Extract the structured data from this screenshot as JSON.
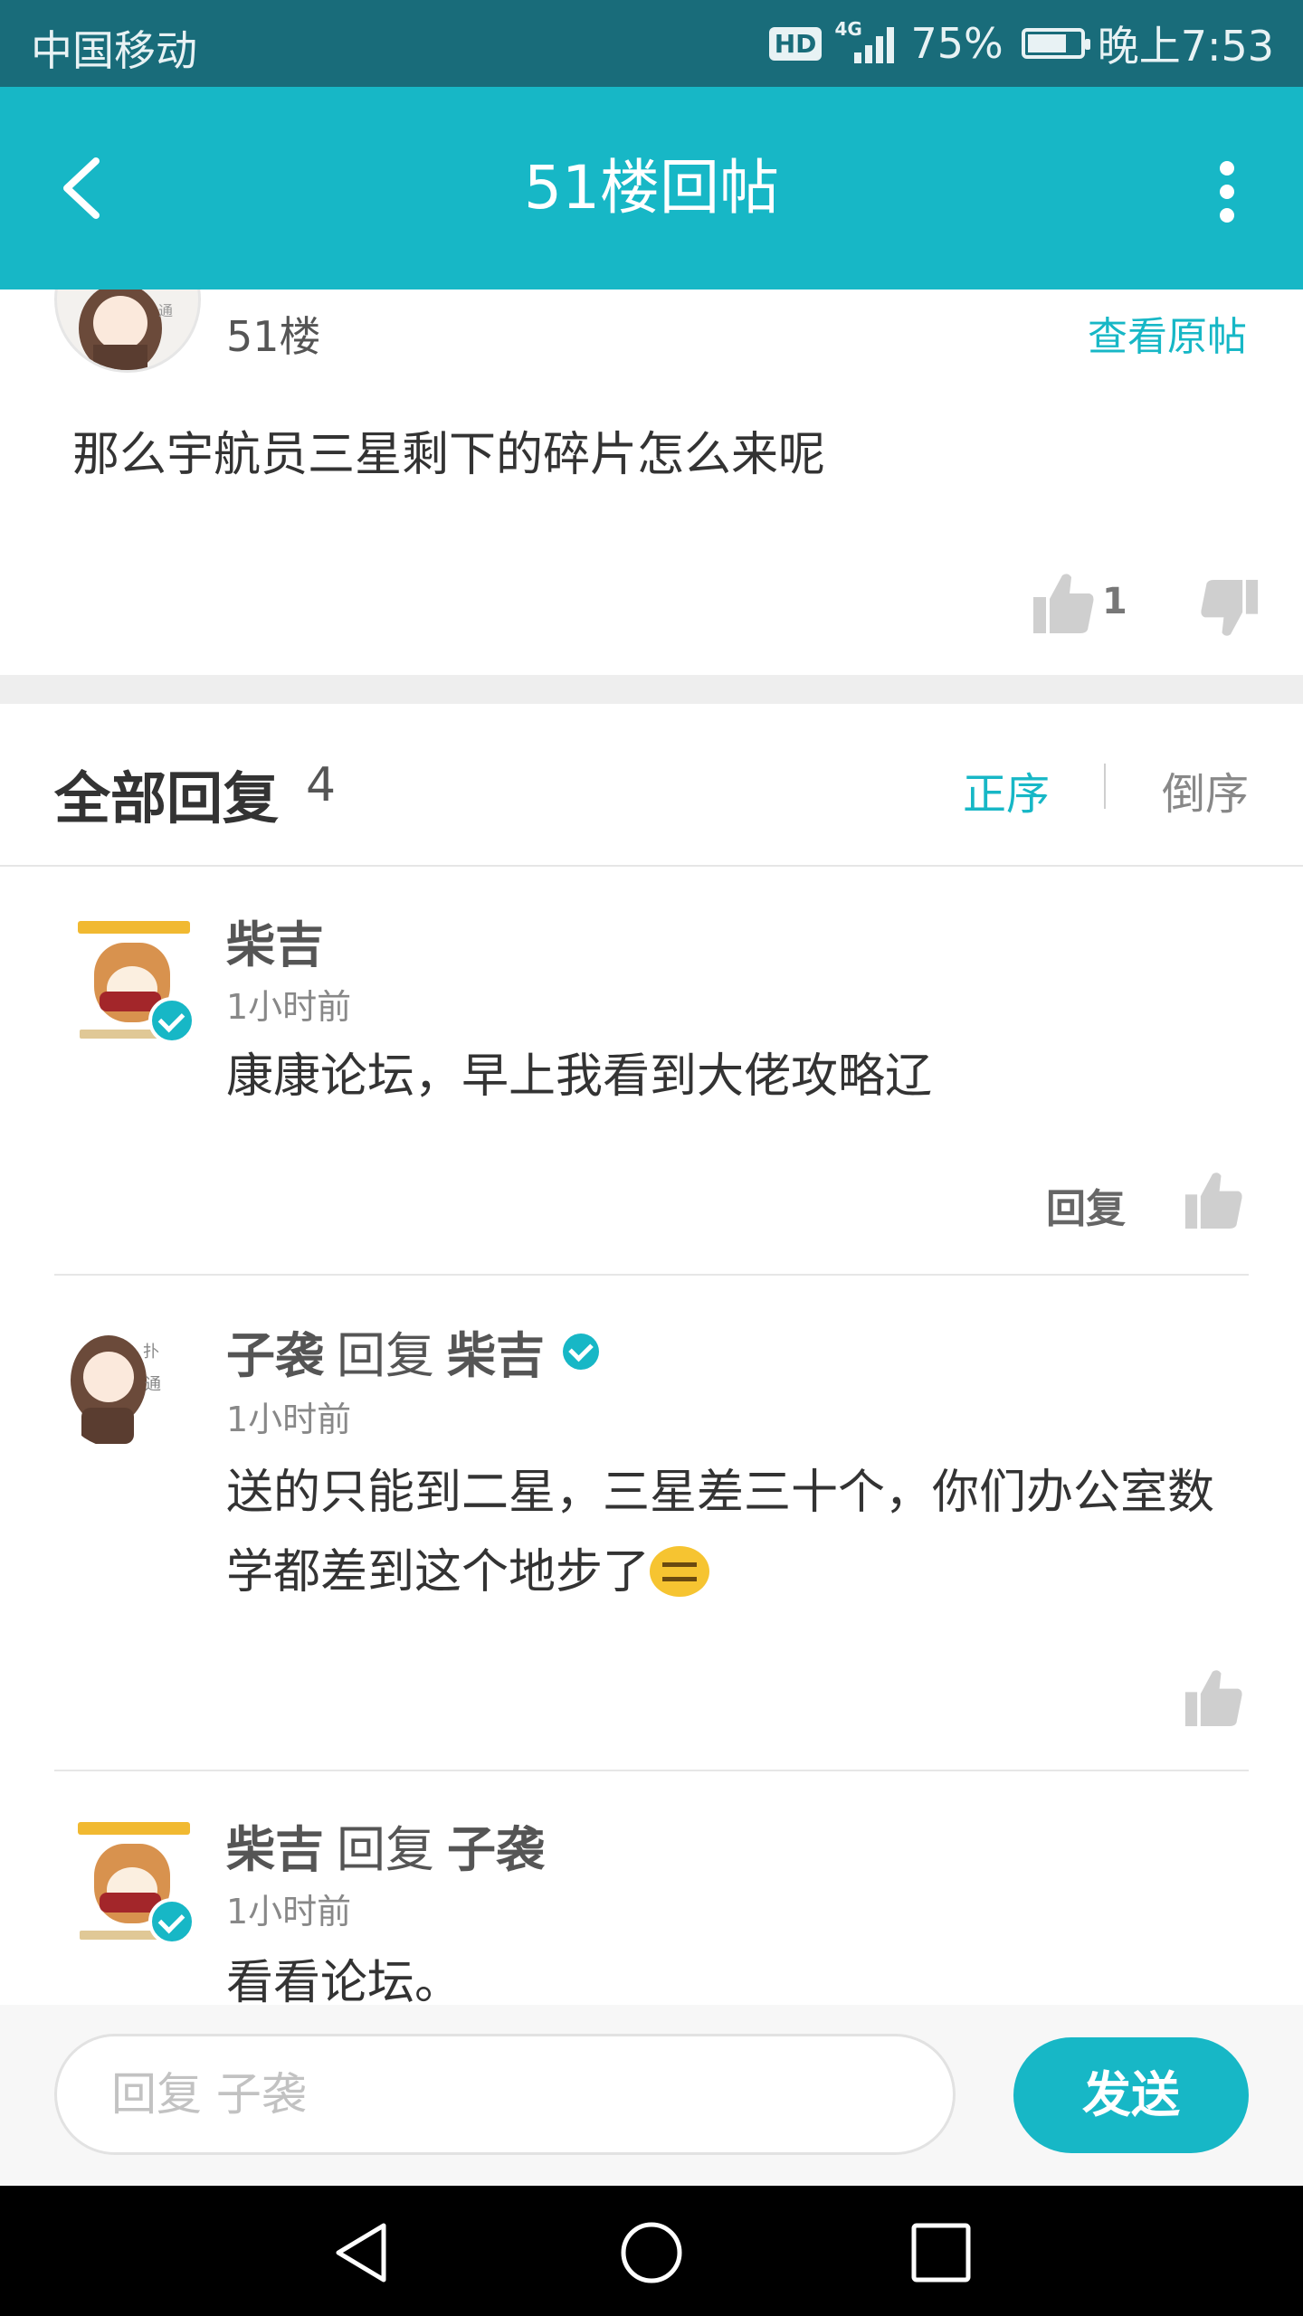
{
  "status_bar": {
    "carrier": "中国移动",
    "network_badge": "HD",
    "network_type": "4G",
    "battery_percent": "75%",
    "battery_level": 0.75,
    "time": "晚上7:53"
  },
  "header": {
    "title": "51楼回帖",
    "back_icon": "back-arrow-icon",
    "more_icon": "more-vertical-icon"
  },
  "post": {
    "floor": "51楼",
    "view_original": "查看原帖",
    "content": "那么宇航员三星剩下的碎片怎么来呢",
    "like_count": "1"
  },
  "replies_header": {
    "label": "全部回复",
    "count": "4",
    "sort_asc": "正序",
    "sort_desc": "倒序"
  },
  "replies": [
    {
      "author": "柴吉",
      "time": "1小时前",
      "text": "康康论坛，早上我看到大佬攻略辽",
      "reply_label": "回复"
    },
    {
      "author": "子袭",
      "reply_word": "回复",
      "target": "柴吉",
      "time": "1小时前",
      "text": "送的只能到二星，三星差三十个，你们办公室数学都差到这个地步了"
    },
    {
      "author": "柴吉",
      "reply_word": "回复",
      "target": "子袭",
      "time": "1小时前",
      "text": "看看论坛。"
    }
  ],
  "input_bar": {
    "placeholder": "回复 子袭",
    "send_label": "发送"
  },
  "colors": {
    "accent": "#17b7c6",
    "status_bar": "#196c7a"
  }
}
